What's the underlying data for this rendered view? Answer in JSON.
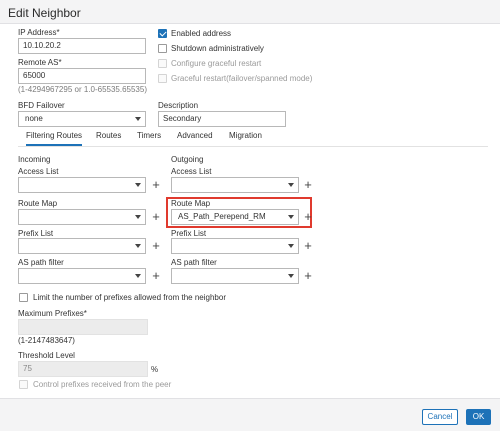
{
  "dialog": {
    "title": "Edit Neighbor",
    "cancel_label": "Cancel",
    "ok_label": "OK"
  },
  "general": {
    "ip_label": "IP Address*",
    "ip_value": "10.10.20.2",
    "enabled_label": "Enabled address",
    "enabled_checked": true,
    "shutdown_label": "Shutdown administratively",
    "graceful_label": "Configure graceful restart",
    "graceful_fail_label": "Graceful restart(failover/spanned mode)",
    "remote_as_label": "Remote AS*",
    "remote_as_value": "65000",
    "remote_as_hint": "(1-4294967295 or 1.0-65535.65535)",
    "bfd_label": "BFD Failover",
    "bfd_value": "none",
    "description_label": "Description",
    "description_value": "Secondary"
  },
  "tabs": [
    {
      "label": "Filtering Routes",
      "active": true
    },
    {
      "label": "Routes",
      "active": false
    },
    {
      "label": "Timers",
      "active": false
    },
    {
      "label": "Advanced",
      "active": false
    },
    {
      "label": "Migration",
      "active": false
    }
  ],
  "filtering": {
    "incoming_header": "Incoming",
    "outgoing_header": "Outgoing",
    "access_list_label": "Access List",
    "route_map_label": "Route Map",
    "prefix_list_label": "Prefix List",
    "as_path_label": "AS path filter",
    "outgoing_route_map_value": "AS_Path_Perepend_RM",
    "plus_glyph": "+"
  },
  "prefix_limit": {
    "limit_label": "Limit the number of prefixes allowed from the neighbor",
    "max_label": "Maximum Prefixes*",
    "max_hint": "(1-2147483647)",
    "threshold_label": "Threshold Level",
    "threshold_value": "75",
    "percent_label": "%",
    "control_label": "Control prefixes received from the peer"
  },
  "colors": {
    "accent": "#1d72b8",
    "highlight": "#e03a2e"
  }
}
